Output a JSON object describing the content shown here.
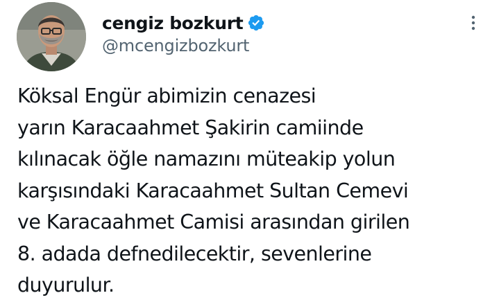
{
  "tweet": {
    "author": {
      "display_name": "cengiz bozkurt",
      "handle": "@mcengizbozkurt",
      "verified": true,
      "avatar_icon": "profile-photo"
    },
    "more_icon": "more-vertical-icon",
    "text_lines": [
      "Köksal Engür abimizin cenazesi",
      "yarın Karacaahmet Şakirin camiinde",
      "kılınacak öğle namazını müteakip yolun",
      "karşısındaki Karacaahmet Sultan Cemevi",
      "ve Karacaahmet Camisi arasından girilen",
      "8. adada defnedilecektir, sevenlerine",
      "duyurulur."
    ]
  },
  "colors": {
    "text": "#0f1419",
    "secondary_text": "#536471",
    "verified_badge": "#1d9bf0",
    "background": "#ffffff"
  }
}
